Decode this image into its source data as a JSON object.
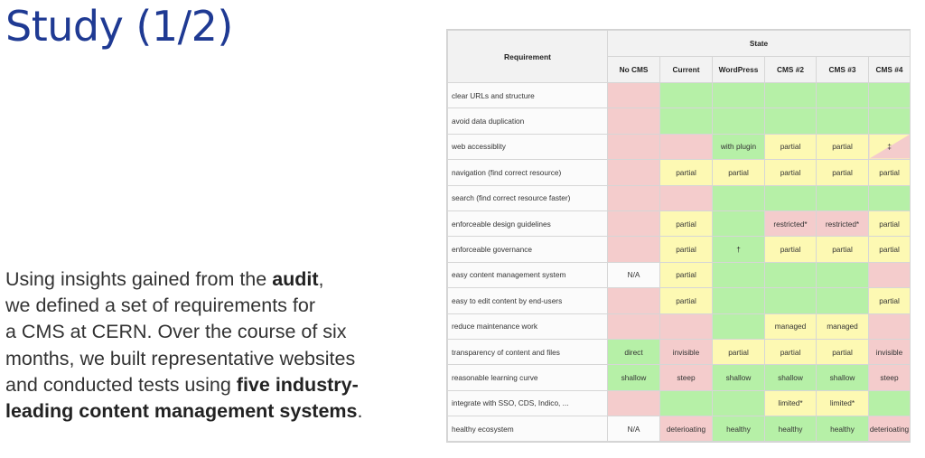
{
  "slide": {
    "title": "Study (1/2)",
    "body": [
      {
        "pre": "Using insights gained from the ",
        "bold": "audit",
        "post": ","
      },
      {
        "pre": "we defined a set of requirements for",
        "bold": "",
        "post": ""
      },
      {
        "pre": "a CMS at CERN. Over the course of six",
        "bold": "",
        "post": ""
      },
      {
        "pre": "months, we built representative websites",
        "bold": "",
        "post": ""
      },
      {
        "pre": "and conducted tests using ",
        "bold": "five industry-",
        "post": ""
      },
      {
        "pre": "",
        "bold": "leading content management systems",
        "post": "."
      }
    ]
  },
  "table": {
    "group_header": "State",
    "requirement_header": "Requirement",
    "columns": [
      "No CMS",
      "Current",
      "WordPress",
      "CMS #2",
      "CMS #3",
      "CMS #4"
    ],
    "rows": [
      {
        "req": "clear URLs and structure",
        "cells": [
          [
            "",
            "r"
          ],
          [
            "",
            "g"
          ],
          [
            "",
            "g"
          ],
          [
            "",
            "g"
          ],
          [
            "",
            "g"
          ],
          [
            "",
            "g"
          ]
        ]
      },
      {
        "req": "avoid data duplication",
        "cells": [
          [
            "",
            "r"
          ],
          [
            "",
            "g"
          ],
          [
            "",
            "g"
          ],
          [
            "",
            "g"
          ],
          [
            "",
            "g"
          ],
          [
            "",
            "g"
          ]
        ]
      },
      {
        "req": "web accessiblity",
        "cells": [
          [
            "",
            "r"
          ],
          [
            "",
            "r"
          ],
          [
            "with plugin",
            "g"
          ],
          [
            "partial",
            "y"
          ],
          [
            "partial",
            "y"
          ],
          [
            "‡",
            "yr"
          ]
        ]
      },
      {
        "req": "navigation (find correct resource)",
        "cells": [
          [
            "",
            "r"
          ],
          [
            "partial",
            "y"
          ],
          [
            "partial",
            "y"
          ],
          [
            "partial",
            "y"
          ],
          [
            "partial",
            "y"
          ],
          [
            "partial",
            "y"
          ]
        ]
      },
      {
        "req": "search (find correct resource faster)",
        "cells": [
          [
            "",
            "r"
          ],
          [
            "",
            "r"
          ],
          [
            "",
            "g"
          ],
          [
            "",
            "g"
          ],
          [
            "",
            "g"
          ],
          [
            "",
            "g"
          ]
        ]
      },
      {
        "req": "enforceable design guidelines",
        "cells": [
          [
            "",
            "r"
          ],
          [
            "partial",
            "y"
          ],
          [
            "",
            "g"
          ],
          [
            "restricted*",
            "r"
          ],
          [
            "restricted*",
            "r"
          ],
          [
            "partial",
            "y"
          ]
        ]
      },
      {
        "req": "enforceable governance",
        "cells": [
          [
            "",
            "r"
          ],
          [
            "partial",
            "y"
          ],
          [
            "†",
            "g"
          ],
          [
            "partial",
            "y"
          ],
          [
            "partial",
            "y"
          ],
          [
            "partial",
            "y"
          ]
        ]
      },
      {
        "req": "easy content management system",
        "cells": [
          [
            "N/A",
            "w"
          ],
          [
            "partial",
            "y"
          ],
          [
            "",
            "g"
          ],
          [
            "",
            "g"
          ],
          [
            "",
            "g"
          ],
          [
            "",
            "r"
          ]
        ]
      },
      {
        "req": "easy to edit content by end-users",
        "cells": [
          [
            "",
            "r"
          ],
          [
            "partial",
            "y"
          ],
          [
            "",
            "g"
          ],
          [
            "",
            "g"
          ],
          [
            "",
            "g"
          ],
          [
            "partial",
            "y"
          ]
        ]
      },
      {
        "req": "reduce maintenance work",
        "cells": [
          [
            "",
            "r"
          ],
          [
            "",
            "r"
          ],
          [
            "",
            "g"
          ],
          [
            "managed",
            "y"
          ],
          [
            "managed",
            "y"
          ],
          [
            "",
            "r"
          ]
        ]
      },
      {
        "req": "transparency of content and files",
        "cells": [
          [
            "direct",
            "g"
          ],
          [
            "invisible",
            "r"
          ],
          [
            "partial",
            "y"
          ],
          [
            "partial",
            "y"
          ],
          [
            "partial",
            "y"
          ],
          [
            "invisible",
            "r"
          ]
        ]
      },
      {
        "req": "reasonable learning curve",
        "cells": [
          [
            "shallow",
            "g"
          ],
          [
            "steep",
            "r"
          ],
          [
            "shallow",
            "g"
          ],
          [
            "shallow",
            "g"
          ],
          [
            "shallow",
            "g"
          ],
          [
            "steep",
            "r"
          ]
        ]
      },
      {
        "req": "integrate with SSO, CDS, Indico, ...",
        "cells": [
          [
            "",
            "r"
          ],
          [
            "",
            "g"
          ],
          [
            "",
            "g"
          ],
          [
            "limited*",
            "y"
          ],
          [
            "limited*",
            "y"
          ],
          [
            "",
            "g"
          ]
        ]
      },
      {
        "req": "healthy ecosystem",
        "cells": [
          [
            "N/A",
            "w"
          ],
          [
            "deterioating",
            "r"
          ],
          [
            "healthy",
            "g"
          ],
          [
            "healthy",
            "g"
          ],
          [
            "healthy",
            "g"
          ],
          [
            "deterioating",
            "r"
          ]
        ]
      }
    ],
    "colors": {
      "g": "#b6f0a7",
      "y": "#fdf9b3",
      "r": "#f4cccc",
      "w": "#fbfbfb"
    }
  }
}
